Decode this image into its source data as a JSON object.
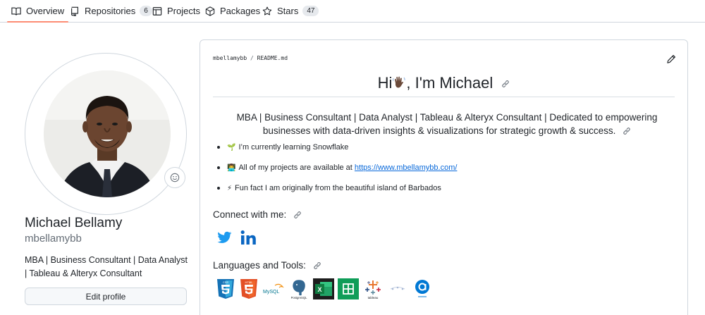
{
  "nav": {
    "tabs": [
      {
        "label": "Overview",
        "icon": "book-icon",
        "selected": true
      },
      {
        "label": "Repositories",
        "icon": "repo-icon",
        "count": "6"
      },
      {
        "label": "Projects",
        "icon": "table-icon"
      },
      {
        "label": "Packages",
        "icon": "package-icon"
      },
      {
        "label": "Stars",
        "icon": "star-icon",
        "count": "47"
      }
    ]
  },
  "profile": {
    "name": "Michael Bellamy",
    "login": "mbellamybb",
    "bio": "MBA | Business Consultant | Data Analyst | Tableau & Alteryx Consultant",
    "edit_label": "Edit profile",
    "status_icon": "smiley-icon"
  },
  "readme": {
    "owner": "mbellamybb",
    "separator": "/",
    "file": "README.md",
    "title_hi": "Hi",
    "title_rest": ", I'm Michael",
    "headline": "MBA | Business Consultant | Data Analyst | Tableau & Alteryx Consultant | Dedicated to empowering businesses with data-driven insights & visualizations for strategic growth & success.",
    "bullets": [
      {
        "emoji": "🌱",
        "text": "I’m currently learning ",
        "strong": "Snowflake"
      },
      {
        "emoji": "👨‍💻",
        "text": "All of my projects are available at ",
        "link": "https://www.mbellamybb.com/"
      },
      {
        "emoji": "⚡",
        "text": "Fun fact ",
        "strong": "I am originally from the beautiful island of Barbados"
      }
    ],
    "connect_heading": "Connect with me:",
    "languages_heading": "Languages and Tools:",
    "tools": {
      "css": "CSS",
      "html": "HTML",
      "mysql": "MySQL",
      "postgres": "PostgreSQL",
      "excel": "X",
      "tableau": "tableau"
    }
  },
  "colors": {
    "accent_underline": "#fd8c73",
    "link": "#0969da",
    "twitter": "#1d9bf0",
    "linkedin": "#0a66c2"
  }
}
